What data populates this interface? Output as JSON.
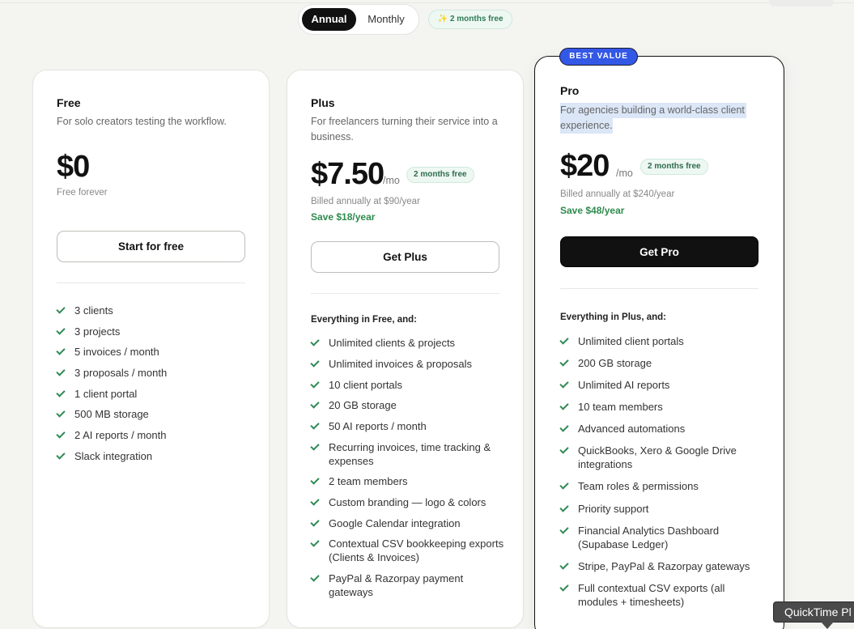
{
  "billing_toggle": {
    "annual_label": "Annual",
    "monthly_label": "Monthly",
    "selected": "Annual",
    "promo": "2 months free",
    "promo_icon": "sparkle-icon"
  },
  "plans": {
    "free": {
      "name": "Free",
      "description": "For solo creators testing the workflow.",
      "price": "$0",
      "note": "Free forever",
      "cta": "Start for free",
      "features": [
        "3 clients",
        "3 projects",
        "5 invoices / month",
        "3 proposals / month",
        "1 client portal",
        "500 MB storage",
        "2 AI reports / month",
        "Slack integration"
      ]
    },
    "plus": {
      "name": "Plus",
      "description_line1": "For freelancers turning their service into a",
      "description_line2": "business.",
      "price": "$7.50",
      "per": "/mo",
      "pill": "2 months free",
      "billed": "Billed annually at $90/year",
      "save": "Save $18/year",
      "cta": "Get Plus",
      "everything": "Everything in Free, and:",
      "features": [
        "Unlimited clients & projects",
        "Unlimited invoices & proposals",
        "10 client portals",
        "20 GB storage",
        "50 AI reports / month",
        "Recurring invoices, time tracking &",
        "expenses",
        "2 team members",
        "Custom branding — logo & colors",
        "Google Calendar integration",
        "Contextual CSV bookkeeping exports",
        "(Clients & Invoices)",
        "PayPal & Razorpay payment",
        "gateways"
      ]
    },
    "pro": {
      "badge": "BEST VALUE",
      "name": "Pro",
      "description_line1": "For agencies building a world-class client",
      "description_line2": "experience.",
      "price": "$20",
      "per": "/mo",
      "pill": "2 months free",
      "billed": "Billed annually at $240/year",
      "save": "Save $48/year",
      "cta": "Get Pro",
      "everything": "Everything in Plus, and:",
      "features": [
        "Unlimited client portals",
        "200 GB storage",
        "Unlimited AI reports",
        "10 team members",
        "Advanced automations",
        "QuickBooks, Xero & Google Drive",
        "integrations",
        "Team roles & permissions",
        "Priority support",
        "Financial Analytics Dashboard",
        "(Supabase Ledger)",
        "Stripe, PayPal & Razorpay gateways",
        "Full contextual CSV exports (all",
        "modules + timesheets)"
      ]
    }
  },
  "tooltip": {
    "text": "QuickTime Pl"
  },
  "colors": {
    "accent_green": "#2f8a55",
    "badge_blue": "#3458e6",
    "dark": "#111111"
  }
}
